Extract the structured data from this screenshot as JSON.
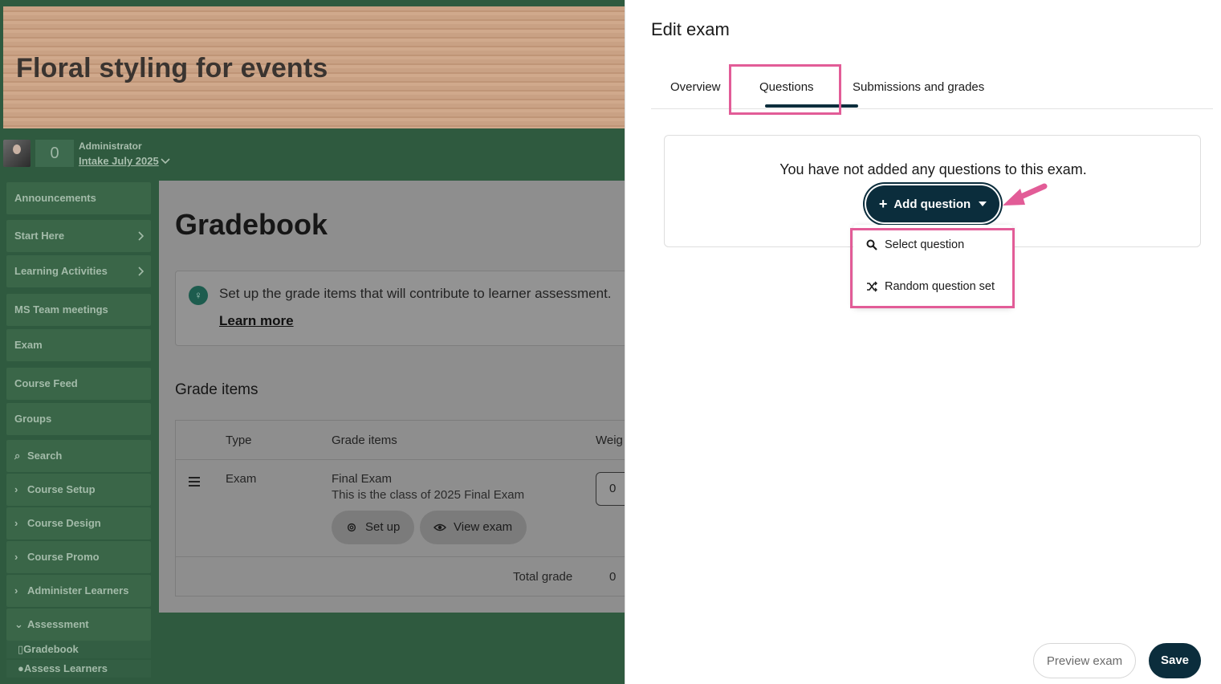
{
  "course": {
    "title": "Floral styling for events"
  },
  "user": {
    "count": "0",
    "role": "Administrator",
    "intake": "Intake July 2025"
  },
  "sidebar": {
    "items": [
      {
        "label": "Announcements"
      },
      {
        "label": "Start Here"
      },
      {
        "label": "Learning Activities"
      },
      {
        "label": "MS Team meetings"
      },
      {
        "label": "Exam"
      },
      {
        "label": "Course Feed"
      },
      {
        "label": "Groups"
      },
      {
        "label": "Search"
      },
      {
        "label": "Course Setup"
      },
      {
        "label": "Course Design"
      },
      {
        "label": "Course Promo"
      },
      {
        "label": "Administer Learners"
      },
      {
        "label": "Assessment"
      }
    ],
    "subitems": [
      {
        "label": "Gradebook"
      },
      {
        "label": "Assess Learners"
      }
    ]
  },
  "gradebook": {
    "title": "Gradebook",
    "info_text": "Set up the grade items that will contribute to learner assessment.",
    "learn_more": "Learn more",
    "grade_items_heading": "Grade items",
    "columns": [
      "Type",
      "Grade items",
      "Weig"
    ],
    "row": {
      "type": "Exam",
      "name": "Final Exam",
      "description": "This is the class of 2025 Final Exam",
      "setup_label": "Set up",
      "view_label": "View exam",
      "weight": "0"
    },
    "total_label": "Total grade",
    "total_value": "0"
  },
  "panel": {
    "title": "Edit exam",
    "tabs": [
      {
        "label": "Overview"
      },
      {
        "label": "Questions"
      },
      {
        "label": "Submissions and grades"
      }
    ],
    "empty_message": "You have not added any questions to this exam.",
    "add_question_label": "Add question",
    "dropdown": [
      {
        "label": "Select question",
        "icon": "search-icon"
      },
      {
        "label": "Random question set",
        "icon": "shuffle-icon"
      }
    ],
    "preview_label": "Preview exam",
    "save_label": "Save"
  },
  "colors": {
    "accent": "#0b2d3c",
    "highlight": "#e25c97",
    "sidebar_bg": "#2f5a3f"
  }
}
